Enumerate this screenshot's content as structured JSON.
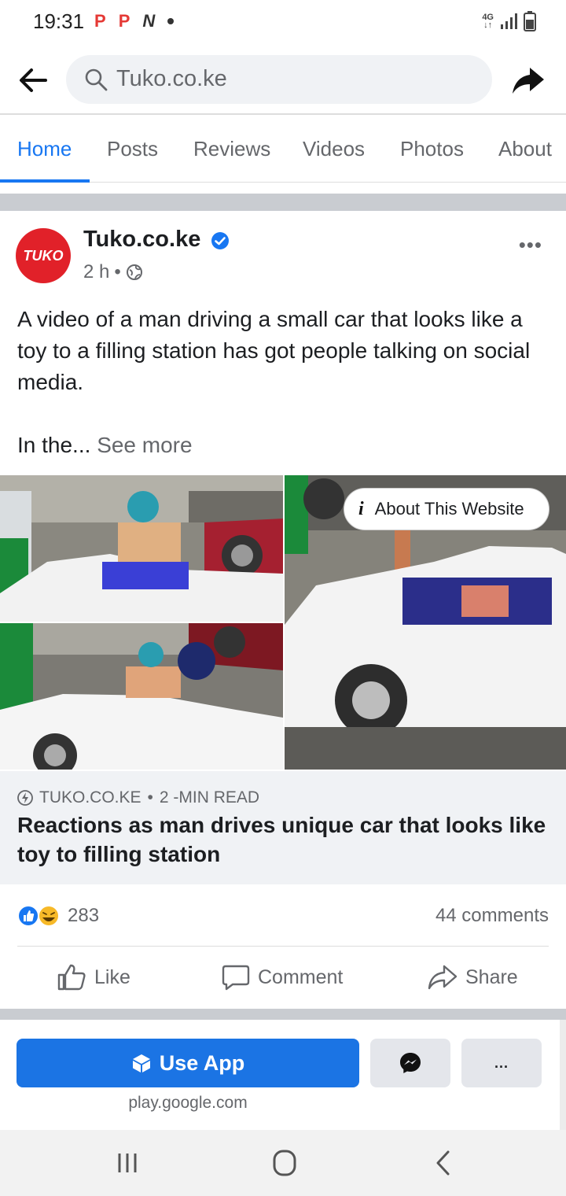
{
  "status_bar": {
    "time": "19:31",
    "notifications": [
      "P",
      "P",
      "N"
    ],
    "network": "4G"
  },
  "header": {
    "search_text": "Tuko.co.ke"
  },
  "tabs": [
    {
      "label": "Home",
      "active": true
    },
    {
      "label": "Posts",
      "active": false
    },
    {
      "label": "Reviews",
      "active": false
    },
    {
      "label": "Videos",
      "active": false
    },
    {
      "label": "Photos",
      "active": false
    },
    {
      "label": "About",
      "active": false
    }
  ],
  "post": {
    "avatar_text": "TUKO",
    "page_name": "Tuko.co.ke",
    "time": "2 h",
    "meta_sep": "•",
    "text": "A video of a man driving a small car that looks like a toy to a filling station has got people talking on social media.",
    "more_prefix": "In the...",
    "see_more": "See more",
    "about_website": "About This Website",
    "brand_color": "#e12129"
  },
  "link_preview": {
    "source": "TUKO.CO.KE",
    "sep": "•",
    "read_time": "2 -MIN READ",
    "title": "Reactions as man drives unique car that looks like toy to filling station"
  },
  "engagement": {
    "reaction_count": "283",
    "comments": "44 comments"
  },
  "actions": {
    "like": "Like",
    "comment": "Comment",
    "share": "Share"
  },
  "app_banner": {
    "use_app": "Use App",
    "more": "...",
    "url": "play.google.com",
    "button_color": "#1b74e4"
  }
}
